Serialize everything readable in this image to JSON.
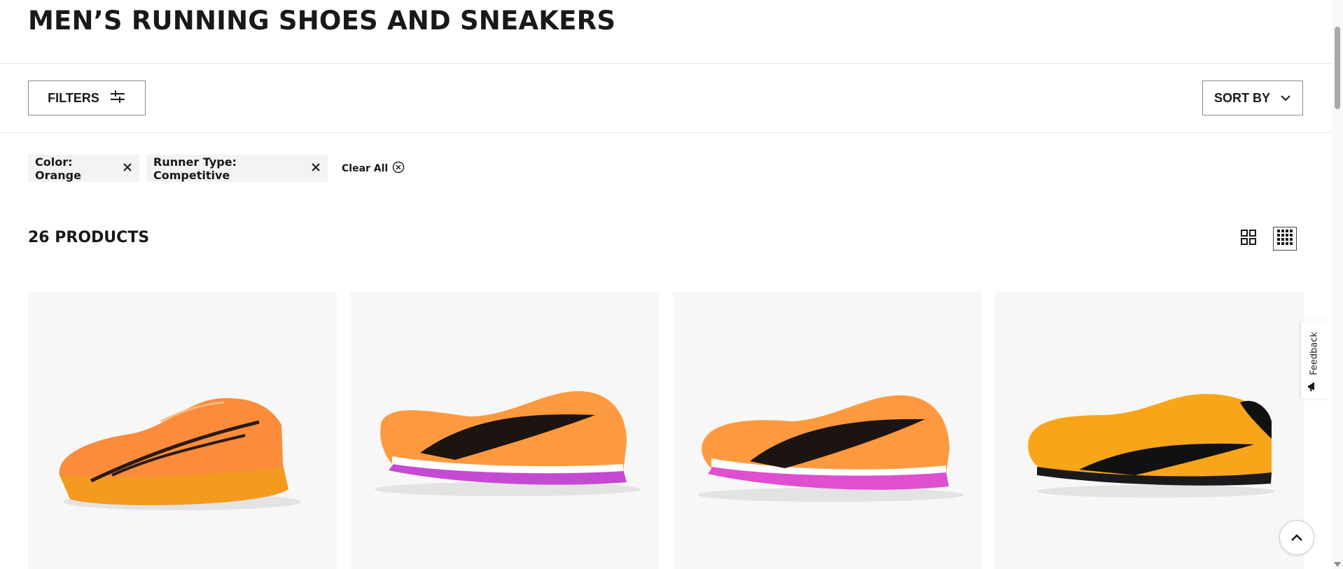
{
  "header": {
    "title": "MEN’S RUNNING SHOES AND SNEAKERS"
  },
  "toolbar": {
    "filters_label": "FILTERS",
    "filters_icon": "sliders-icon",
    "sort_label": "SORT BY",
    "sort_icon": "chevron-down-icon"
  },
  "active_filters": [
    {
      "label": "Color: Orange",
      "icon": "close-icon"
    },
    {
      "label": "Runner Type: Competitive",
      "icon": "close-icon"
    }
  ],
  "clear_all": {
    "label": "Clear All",
    "icon": "circle-close-icon"
  },
  "results": {
    "count_label": "26 PRODUCTS",
    "view_options": [
      "grid-large-icon",
      "grid-small-icon"
    ],
    "selected_view": "grid-small-icon"
  },
  "products": [
    {
      "image": "orange-racing-shoe",
      "colors": {
        "upper": "#fb8c3c",
        "sole": "#f39a1f",
        "stripe": "#2a1a14"
      }
    },
    {
      "image": "orange-pink-spike-shoe",
      "colors": {
        "upper": "#fd9a3f",
        "sole": "#c54ad3",
        "stripe": "#1c1410"
      }
    },
    {
      "image": "orange-pink-spike-shoe",
      "colors": {
        "upper": "#fd9a3f",
        "sole": "#df4fcf",
        "stripe": "#1c1410"
      }
    },
    {
      "image": "yellow-black-spike-shoe",
      "colors": {
        "upper": "#f9a519",
        "sole": "#1a1a1a",
        "stripe": "#111111"
      }
    }
  ],
  "feedback": {
    "label": "Feedback",
    "icon": "megaphone-icon"
  },
  "back_to_top": {
    "icon": "chevron-up-icon"
  },
  "colors": {
    "text": "#191919",
    "chip_bg": "#f3f3f3",
    "card_bg": "#f7f7f7",
    "divider": "#e5e5e5"
  }
}
